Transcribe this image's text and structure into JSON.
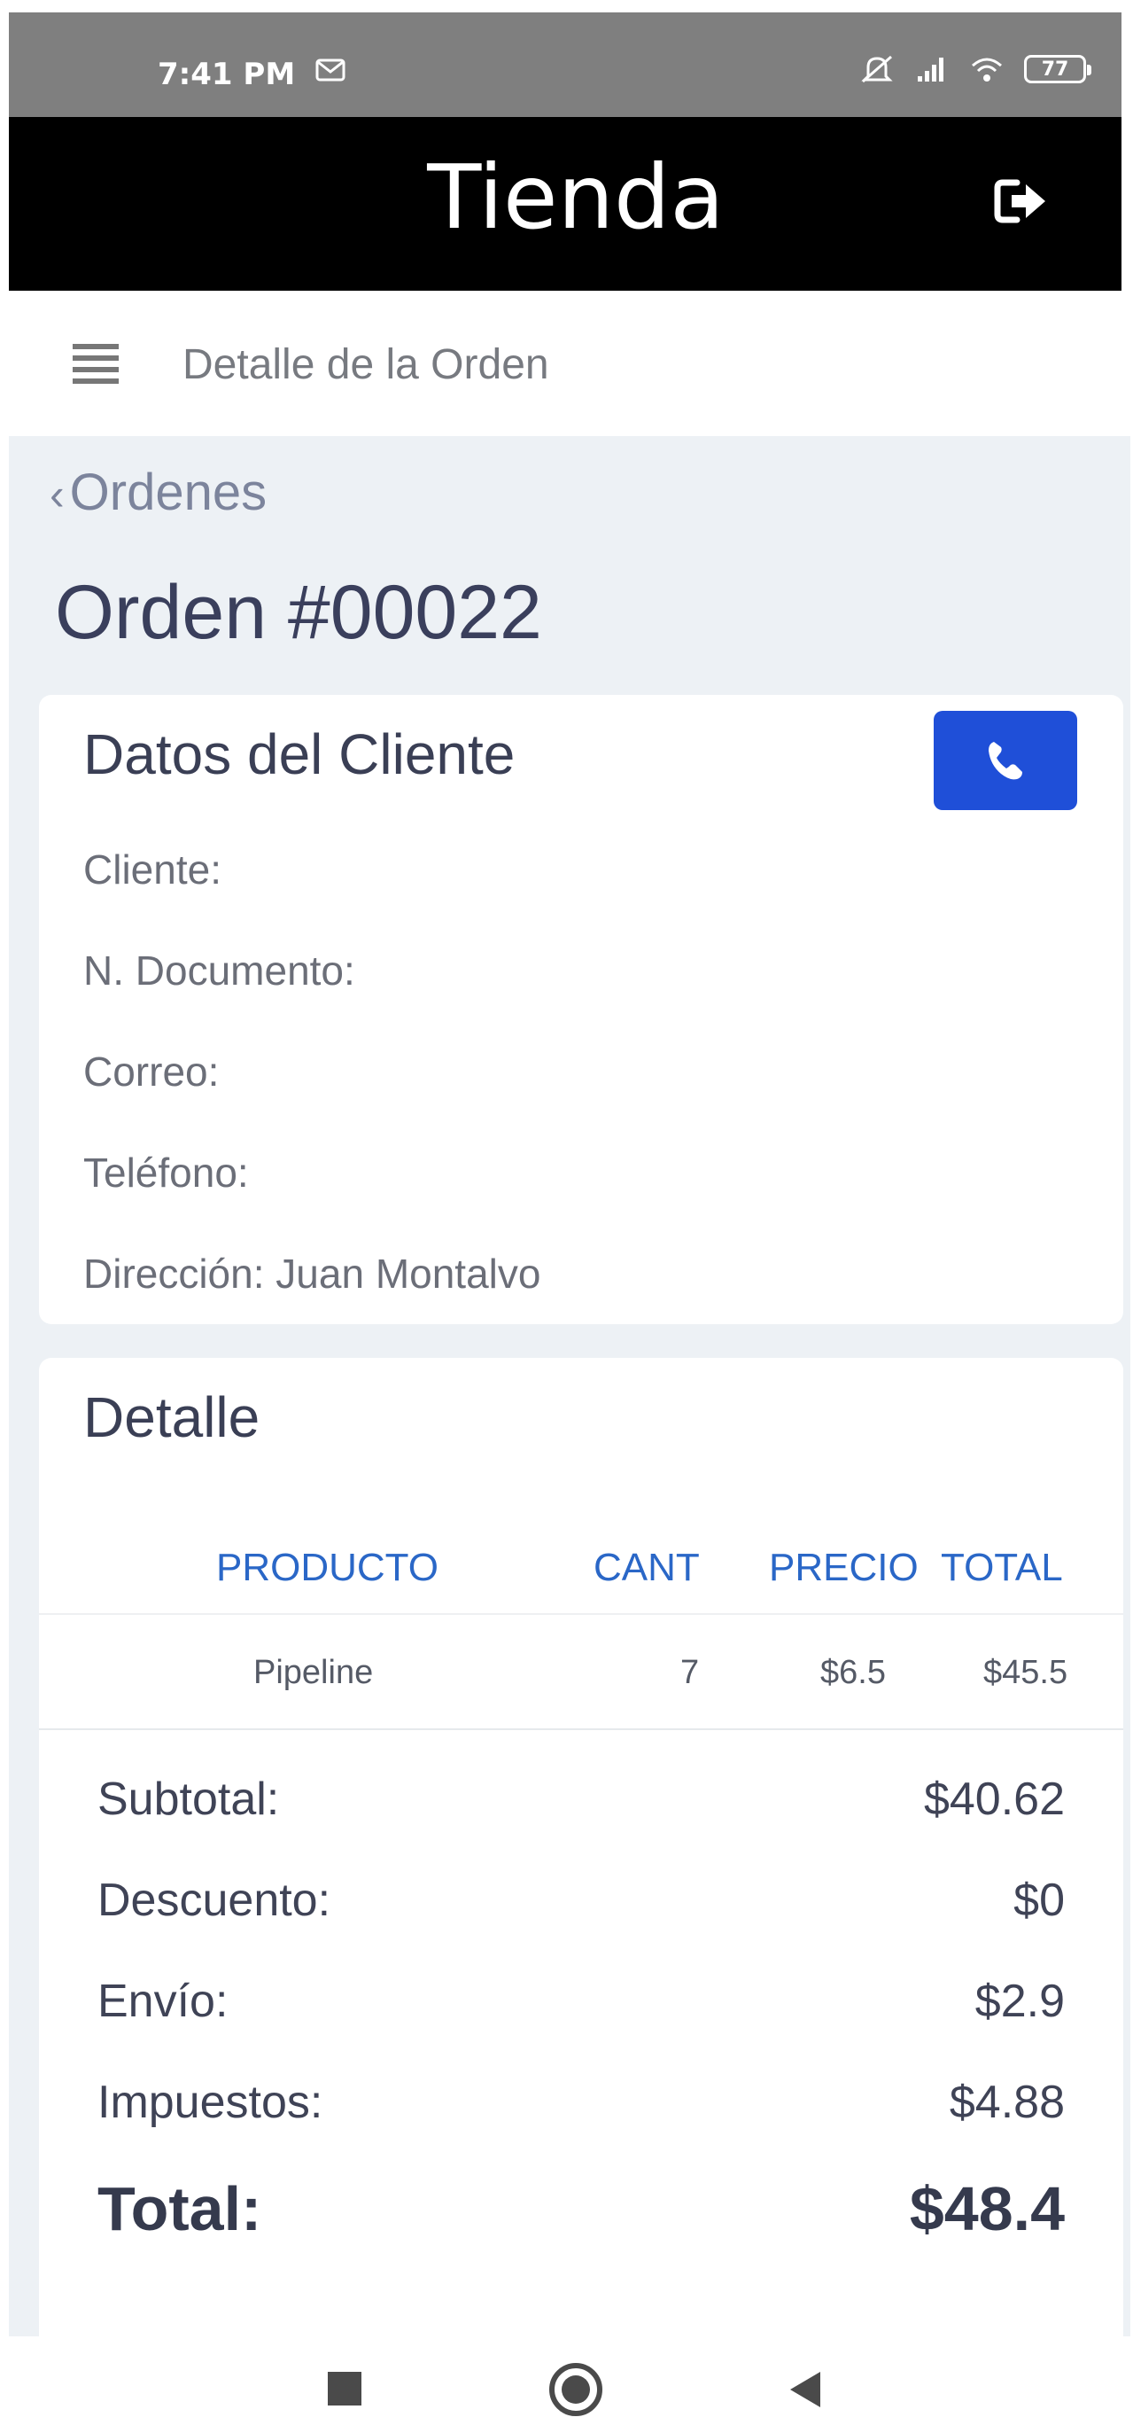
{
  "status_bar": {
    "time": "7:41 PM",
    "battery": "77",
    "icons": [
      "mail-icon",
      "mute-icon",
      "signal-icon",
      "wifi-icon",
      "battery-icon"
    ]
  },
  "header": {
    "title": "Tienda",
    "logout_icon": "logout-icon",
    "background": "#000000"
  },
  "sub_header": {
    "title": "Detalle de la Orden",
    "menu_icon": "menu-icon"
  },
  "breadcrumb": {
    "back_label": "Ordenes"
  },
  "order": {
    "title": "Orden #00022"
  },
  "client": {
    "title": "Datos del Cliente",
    "call_icon": "phone-icon",
    "call_button_color": "#1f4fd8",
    "rows": [
      "Cliente:",
      "N. Documento:",
      "Correo:",
      "Teléfono:",
      "Dirección: Juan Montalvo"
    ]
  },
  "detail": {
    "title": "Detalle",
    "columns": [
      "PRODUCTO",
      "CANT",
      "PRECIO",
      "TOTAL"
    ],
    "items": [
      {
        "product": "Pipeline",
        "qty": "7",
        "price": "$6.5",
        "total": "$45.5"
      }
    ],
    "summary": [
      {
        "label": "Subtotal:",
        "value": "$40.62"
      },
      {
        "label": "Descuento:",
        "value": "$0"
      },
      {
        "label": "Envío:",
        "value": "$2.9"
      },
      {
        "label": "Impuestos:",
        "value": "$4.88"
      }
    ],
    "total": {
      "label": "Total:",
      "value": "$48.4"
    },
    "accent_color": "#2a67c7"
  },
  "nav_bar": {
    "icons": [
      "recent-apps-icon",
      "home-icon",
      "back-icon"
    ]
  }
}
